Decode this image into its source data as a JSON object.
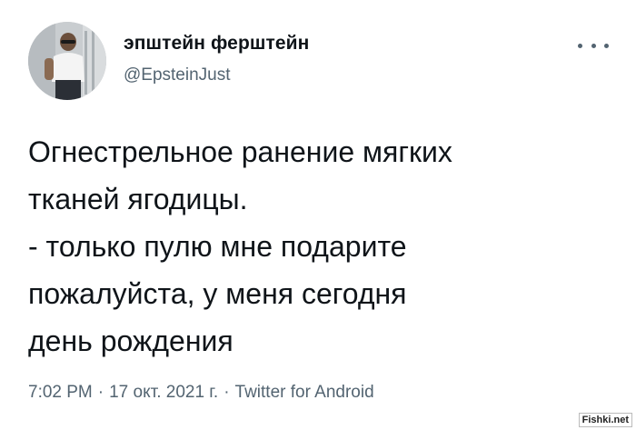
{
  "author": {
    "display_name": "эпштейн ферштейн",
    "handle": "@EpsteinJust"
  },
  "more_menu": {
    "icon": "more-dots-icon"
  },
  "tweet": {
    "lines": [
      "Огнестрельное ранение мягких",
      "тканей ягодицы.",
      "- только пулю мне подарите",
      "пожалуйста, у меня сегодня",
      "день рождения"
    ]
  },
  "meta": {
    "time": "7:02 PM",
    "separator": "·",
    "date": "17 окт. 2021 г.",
    "source": "Twitter for Android"
  },
  "watermark": {
    "text": "Fishki.net"
  },
  "colors": {
    "text_primary": "#0f1419",
    "text_secondary": "#536471",
    "background": "#ffffff"
  }
}
